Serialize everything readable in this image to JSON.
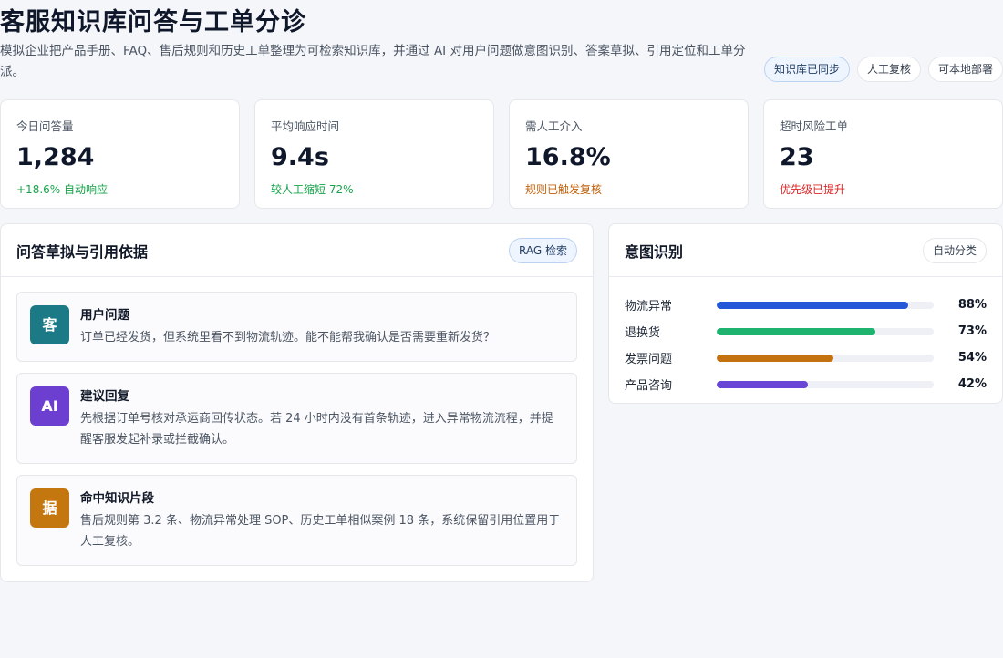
{
  "header": {
    "title": "客服知识库问答与工单分诊",
    "description": "模拟企业把产品手册、FAQ、售后规则和历史工单整理为可检索知识库，并通过 AI 对用户问题做意图识别、答案草拟、引用定位和工单分派。",
    "badges": [
      {
        "label": "知识库已同步"
      },
      {
        "label": "人工复核"
      },
      {
        "label": "可本地部署"
      }
    ]
  },
  "stats": [
    {
      "label": "今日问答量",
      "value": "1,284",
      "note": "+18.6% 自动响应",
      "note_color": "#16a34a"
    },
    {
      "label": "平均响应时间",
      "value": "9.4s",
      "note": "较人工缩短 72%",
      "note_color": "#16a34a"
    },
    {
      "label": "需人工介入",
      "value": "16.8%",
      "note": "规则已触发复核",
      "note_color": "#c2610c"
    },
    {
      "label": "超时风险工单",
      "value": "23",
      "note": "优先级已提升",
      "note_color": "#dc2626"
    }
  ],
  "qa_panel": {
    "title": "问答草拟与引用依据",
    "chip": "RAG 检索",
    "items": [
      {
        "icon_text": "客",
        "icon_color": "#1b7a86",
        "title": "用户问题",
        "text": "订单已经发货，但系统里看不到物流轨迹。能不能帮我确认是否需要重新发货？"
      },
      {
        "icon_text": "AI",
        "icon_color": "#6d3fd0",
        "title": "建议回复",
        "text": "先根据订单号核对承运商回传状态。若 24 小时内没有首条轨迹，进入异常物流流程，并提醒客服发起补录或拦截确认。"
      },
      {
        "icon_text": "据",
        "icon_color": "#c4760f",
        "title": "命中知识片段",
        "text": "售后规则第 3.2 条、物流异常处理 SOP、历史工单相似案例 18 条，系统保留引用位置用于人工复核。"
      }
    ]
  },
  "intent_panel": {
    "title": "意图识别",
    "chip": "自动分类",
    "rows": [
      {
        "label": "物流异常",
        "percent": 88,
        "percent_text": "88%",
        "color": "#2458d8"
      },
      {
        "label": "退换货",
        "percent": 73,
        "percent_text": "73%",
        "color": "#1fb370"
      },
      {
        "label": "发票问题",
        "percent": 54,
        "percent_text": "54%",
        "color": "#c4720f"
      },
      {
        "label": "产品咨询",
        "percent": 42,
        "percent_text": "42%",
        "color": "#6a46d6"
      }
    ]
  }
}
